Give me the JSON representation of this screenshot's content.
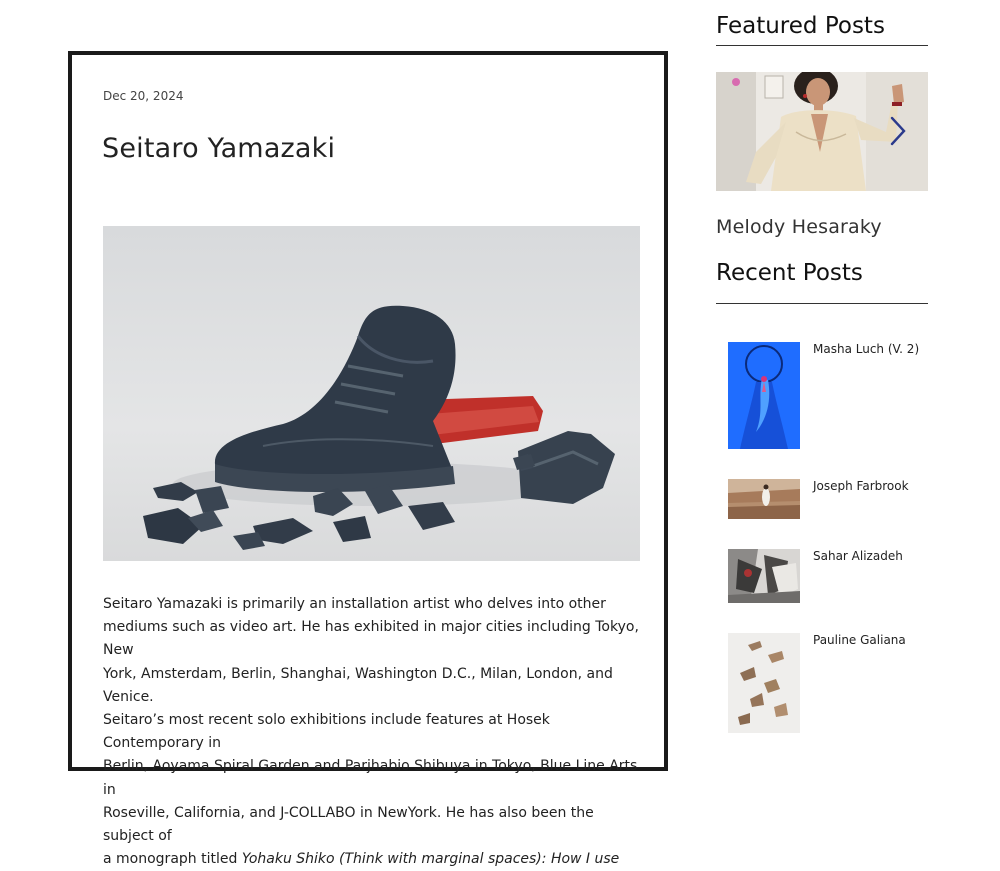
{
  "post": {
    "date": "Dec 20, 2024",
    "title": "Seitaro Yamazaki",
    "body_lines": [
      "Seitaro Yamazaki is primarily an installation artist who delves into other",
      "mediums such as video art. He has exhibited in major cities including Tokyo, New",
      "York, Amsterdam, Berlin, Shanghai, Washington D.C., Milan, London, and Venice.",
      "Seitaro’s most recent solo exhibitions include features at Hosek Contemporary in",
      "Berlin, Aoyama Spiral Garden and Parjhabio Shibuya in Tokyo, Blue Line Arts in",
      "Roseville, California, and J-COLLABO in NewYork. He has also been the subject of"
    ],
    "body_last_prefix": "a monograph titled ",
    "body_last_italic": "Yohaku Shiko (Think with marginal spaces): How I use",
    "image_icon": "broken-stone-sneaker-sculpture"
  },
  "featured": {
    "heading": "Featured Posts",
    "post_title": "Melody Hesaraky",
    "image_icon": "portrait-photo",
    "next_icon": "chevron-right-icon"
  },
  "recent": {
    "heading": "Recent Posts",
    "items": [
      {
        "label": "Masha Luch (V. 2)",
        "thumb_icon": "blue-figure-illustration"
      },
      {
        "label": "Joseph Farbrook",
        "thumb_icon": "desert-figure-photo"
      },
      {
        "label": "Sahar Alizadeh",
        "thumb_icon": "monochrome-painting"
      },
      {
        "label": "Pauline Galiana",
        "thumb_icon": "wall-sculpture-photo"
      }
    ]
  },
  "colors": {
    "frame": "#1a1a1a",
    "text": "#222222",
    "accent_blue": "#1e6bff",
    "arrow": "#2b3a8c"
  }
}
